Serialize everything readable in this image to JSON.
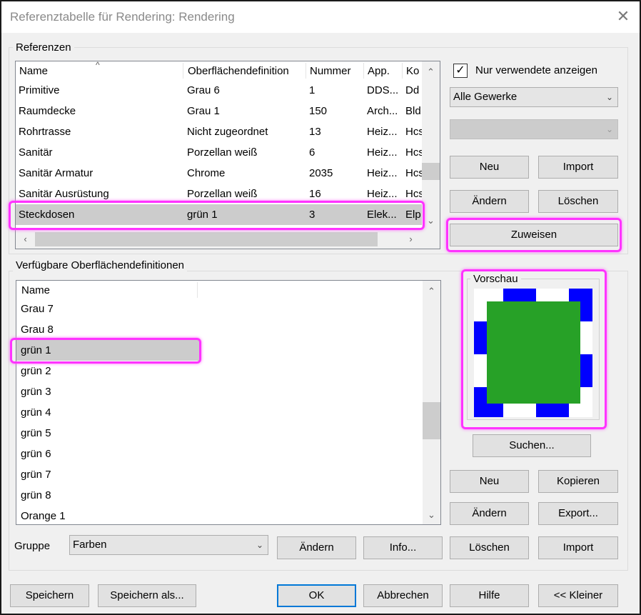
{
  "window": {
    "title": "Referenztabelle für Rendering: Rendering",
    "close_glyph": "✕"
  },
  "referenzen": {
    "label": "Referenzen",
    "columns": [
      "Name",
      "Oberflächendefinition",
      "Nummer",
      "App.",
      "Ko"
    ],
    "rows": [
      [
        "Primitive",
        "Grau 6",
        "1",
        "DDS...",
        "Dd"
      ],
      [
        "Raumdecke",
        "Grau 1",
        "150",
        "Arch...",
        "Bld"
      ],
      [
        "Rohrtrasse",
        "Nicht zugeordnet",
        "13",
        "Heiz...",
        "Hcs"
      ],
      [
        "Sanitär",
        "Porzellan weiß",
        "6",
        "Heiz...",
        "Hcs"
      ],
      [
        "Sanitär Armatur",
        "Chrome",
        "2035",
        "Heiz...",
        "Hcs"
      ],
      [
        "Sanitär Ausrüstung",
        "Porzellan weiß",
        "16",
        "Heiz...",
        "Hcs"
      ],
      [
        "Steckdosen",
        "grün 1",
        "3",
        "Elek...",
        "Elp"
      ]
    ],
    "selected_row": 6
  },
  "right_top": {
    "only_used_label": "Nur verwendete anzeigen",
    "only_used_checked": "✓",
    "gewerke_value": "Alle Gewerke",
    "secondary_value": "",
    "neu": "Neu",
    "import": "Import",
    "aendern": "Ändern",
    "loeschen": "Löschen",
    "zuweisen": "Zuweisen"
  },
  "verfuegbare": {
    "label": "Verfügbare Oberflächendefinitionen",
    "column": "Name",
    "items": [
      "Grau 7",
      "Grau 8",
      "grün 1",
      "grün 2",
      "grün 3",
      "grün 4",
      "grün 5",
      "grün 6",
      "grün 7",
      "grün 8",
      "Orange 1"
    ],
    "selected_index": 2
  },
  "vorschau": {
    "label": "Vorschau",
    "fill_color": "#27a127",
    "checker_color": "#0000ff"
  },
  "right_bottom": {
    "suchen": "Suchen...",
    "neu": "Neu",
    "kopieren": "Kopieren",
    "aendern": "Ändern",
    "export": "Export...",
    "loeschen": "Löschen",
    "import": "Import"
  },
  "gruppe": {
    "label": "Gruppe",
    "value": "Farben",
    "aendern": "Ändern",
    "info": "Info..."
  },
  "footer": {
    "speichern": "Speichern",
    "speichern_als": "Speichern als...",
    "ok": "OK",
    "abbrechen": "Abbrechen",
    "hilfe": "Hilfe",
    "kleiner": "<< Kleiner"
  },
  "highlight_color": "#ff33ff"
}
